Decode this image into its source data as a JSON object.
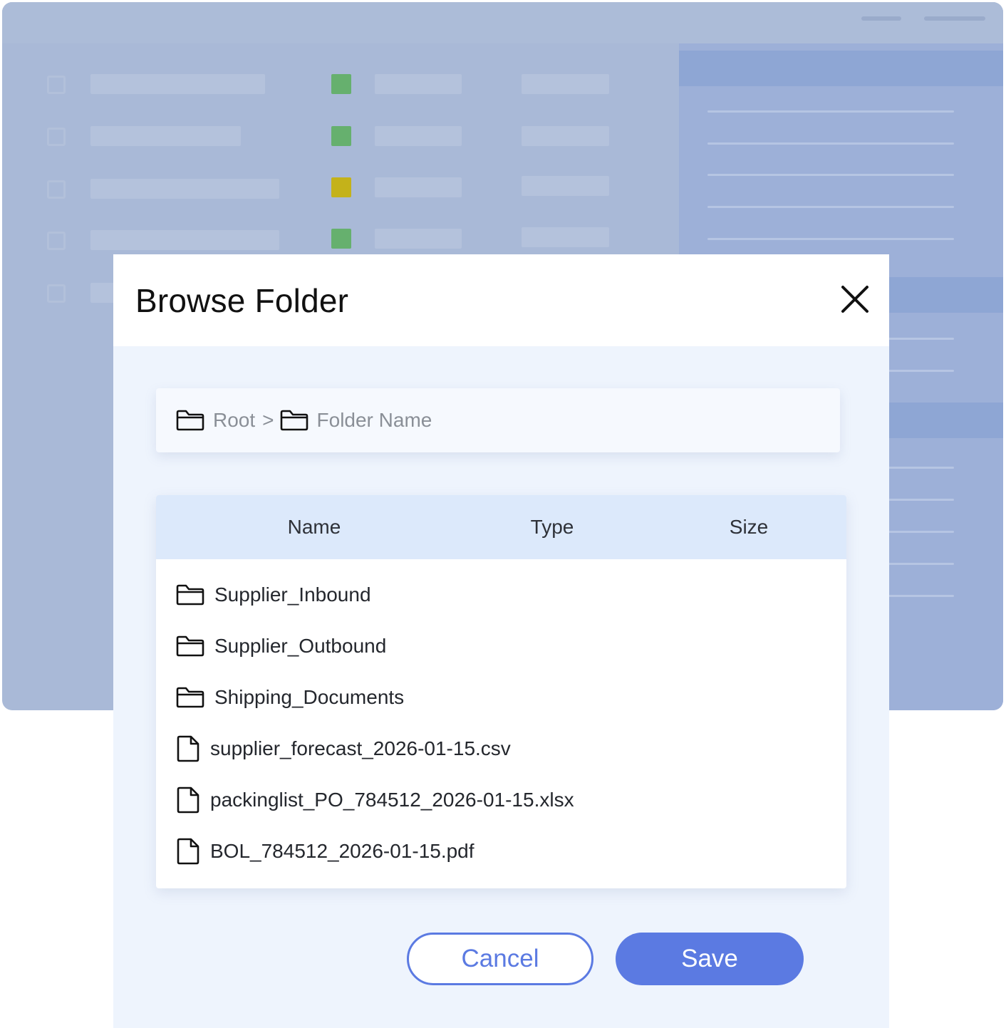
{
  "dialog": {
    "title": "Browse Folder",
    "close_icon": "close-icon"
  },
  "breadcrumb": {
    "items": [
      {
        "label": "Root",
        "icon": "folder-icon"
      },
      {
        "label": "Folder Name",
        "icon": "folder-icon"
      }
    ],
    "separator": ">"
  },
  "table": {
    "columns": [
      "Name",
      "Type",
      "Size"
    ],
    "rows": [
      {
        "name": "Supplier_Inbound",
        "kind": "folder",
        "icon": "folder-icon"
      },
      {
        "name": "Supplier_Outbound",
        "kind": "folder",
        "icon": "folder-icon"
      },
      {
        "name": "Shipping_Documents",
        "kind": "folder",
        "icon": "folder-icon"
      },
      {
        "name": "supplier_forecast_2026-01-15.csv",
        "kind": "file",
        "icon": "file-icon"
      },
      {
        "name": "packinglist_PO_784512_2026-01-15.xlsx",
        "kind": "file",
        "icon": "file-icon"
      },
      {
        "name": "BOL_784512_2026-01-15.pdf",
        "kind": "file",
        "icon": "file-icon"
      }
    ]
  },
  "actions": {
    "cancel_label": "Cancel",
    "save_label": "Save"
  },
  "colors": {
    "accent": "#5b7ae2",
    "table_header": "#dce9fb",
    "dialog_body": "#eef4fd",
    "status_green": "#66b06e",
    "status_yellow": "#c4b21a"
  }
}
